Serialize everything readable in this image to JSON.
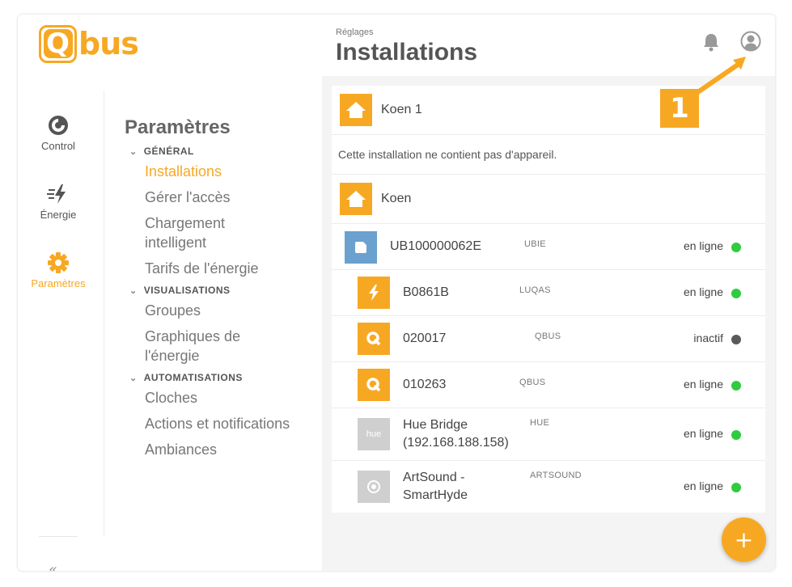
{
  "brand": {
    "logo_letter": "Q",
    "logo_text": "bus",
    "color_accent": "#f7a823"
  },
  "rail": {
    "items": [
      {
        "label": "Control",
        "icon": "control-icon"
      },
      {
        "label": "Énergie",
        "icon": "energy-bolt-icon"
      },
      {
        "label": "Paramètres",
        "icon": "gear-icon"
      }
    ],
    "collapse_glyph": "«"
  },
  "menu": {
    "title": "Paramètres",
    "sections": [
      {
        "label": "GÉNÉRAL",
        "items": [
          "Installations",
          "Gérer l'accès",
          "Chargement intelligent",
          "Tarifs de l'énergie"
        ]
      },
      {
        "label": "VISUALISATIONS",
        "items": [
          "Groupes",
          "Graphiques de l'énergie"
        ]
      },
      {
        "label": "AUTOMATISATIONS",
        "items": [
          "Cloches",
          "Actions et notifications",
          "Ambiances"
        ]
      }
    ],
    "active_item": "Installations"
  },
  "header": {
    "breadcrumb": "Réglages",
    "title": "Installations"
  },
  "installations": [
    {
      "name": "Koen 1",
      "empty_text": "Cette installation ne contient pas d'appareil."
    },
    {
      "name": "Koen"
    }
  ],
  "devices": [
    {
      "name": "UB100000062E",
      "type": "UBIE",
      "status": "en ligne",
      "status_color": "#2ecc40",
      "icon": "ubie-icon",
      "icon_color": "#6aa1cf"
    },
    {
      "name": "B0861B",
      "type": "LUQAS",
      "status": "en ligne",
      "status_color": "#2ecc40",
      "icon": "bolt-icon",
      "icon_color": "#f7a823"
    },
    {
      "name": "020017",
      "type": "QBUS",
      "status": "inactif",
      "status_color": "#5a5a5a",
      "icon": "qbus-icon",
      "icon_color": "#f7a823"
    },
    {
      "name": "010263",
      "type": "QBUS",
      "status": "en ligne",
      "status_color": "#2ecc40",
      "icon": "qbus-icon",
      "icon_color": "#f7a823"
    },
    {
      "name_line1": "Hue Bridge",
      "name_line2": "(192.168.188.158)",
      "type": "HUE",
      "status": "en ligne",
      "status_color": "#2ecc40",
      "icon": "hue-icon",
      "icon_label": "hue",
      "icon_color": "#cfcfcf"
    },
    {
      "name_line1": "ArtSound -",
      "name_line2": "SmartHyde",
      "type": "ARTSOUND",
      "status": "en ligne",
      "status_color": "#2ecc40",
      "icon": "speaker-icon",
      "icon_color": "#cfcfcf"
    }
  ],
  "fab": {
    "label": "+"
  },
  "callout": {
    "number": "1"
  }
}
